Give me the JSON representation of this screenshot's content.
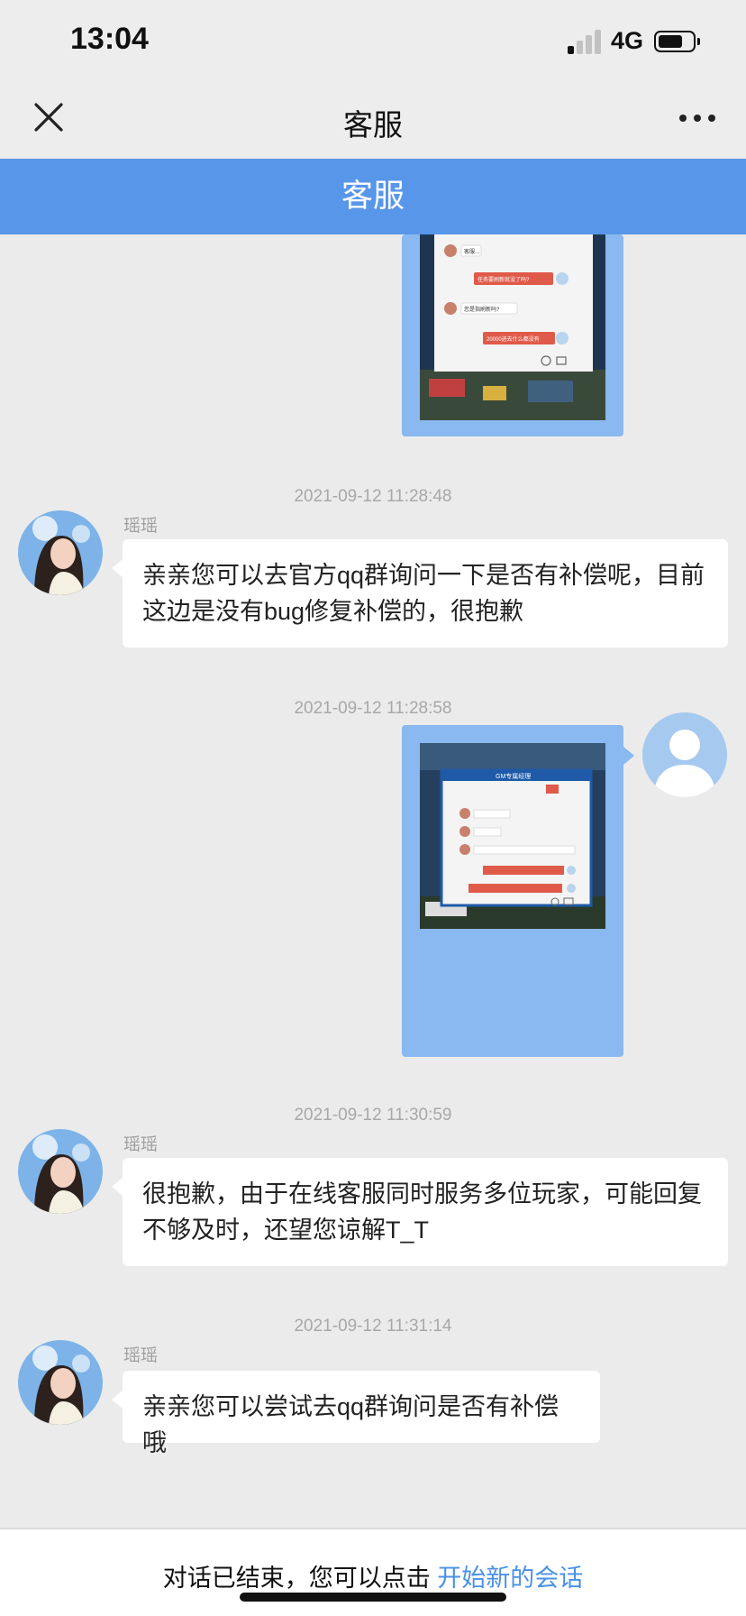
{
  "status_bar": {
    "time": "13:04",
    "network": "4G",
    "signal_bars_active": 1,
    "signal_bars_total": 4
  },
  "nav": {
    "title": "客服",
    "close_icon": "close-icon",
    "more_icon": "more-dots-icon"
  },
  "header_banner": {
    "title": "客服"
  },
  "messages": [
    {
      "type": "image",
      "from": "user",
      "embedded_lines": [
        "客服...",
        "任务要刷新就没了吗?",
        "您是指刷新吗?",
        "20000进去什么都没有"
      ]
    },
    {
      "type": "text",
      "from": "agent",
      "time": "2021-09-12 11:28:48",
      "sender": "瑶瑶",
      "lines": [
        "亲亲您可以去官方qq群询问一下是否有补偿呢，目前",
        "这边是没有bug修复补偿的，很抱歉"
      ]
    },
    {
      "type": "image",
      "from": "user",
      "time": "2021-09-12 11:28:58",
      "embedded_lines": [
        "GM专属经理"
      ]
    },
    {
      "type": "text",
      "from": "agent",
      "time": "2021-09-12 11:30:59",
      "sender": "瑶瑶",
      "lines": [
        "很抱歉，由于在线客服同时服务多位玩家，可能回复",
        "不够及时，还望您谅解T_T"
      ]
    },
    {
      "type": "text",
      "from": "agent",
      "time": "2021-09-12 11:31:14",
      "sender": "瑶瑶",
      "lines": [
        "亲亲您可以尝试去qq群询问是否有补偿哦"
      ]
    }
  ],
  "footer": {
    "text": "对话已结束，您可以点击 ",
    "link": "开始新的会话"
  },
  "colors": {
    "banner": "#5896ea",
    "image_bubble": "#8ab8f0",
    "link": "#4a90e8",
    "background": "#ebebeb"
  }
}
